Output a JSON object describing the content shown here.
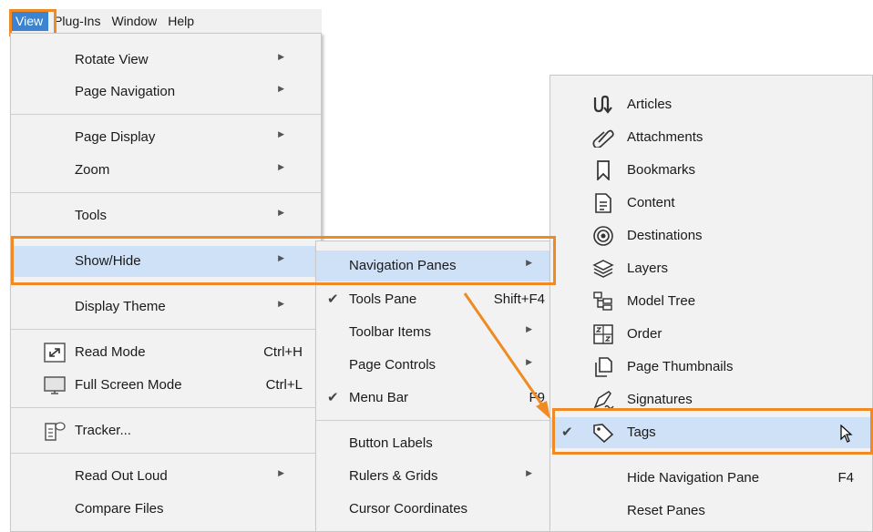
{
  "menubar": {
    "view": "View",
    "plugins": "Plug-Ins",
    "window": "Window",
    "help": "Help"
  },
  "view_menu": {
    "rotate_view": "Rotate View",
    "page_navigation": "Page Navigation",
    "page_display": "Page Display",
    "zoom": "Zoom",
    "tools": "Tools",
    "show_hide": "Show/Hide",
    "display_theme": "Display Theme",
    "read_mode": "Read Mode",
    "read_mode_sc": "Ctrl+H",
    "full_screen": "Full Screen Mode",
    "full_screen_sc": "Ctrl+L",
    "tracker": "Tracker...",
    "read_out_loud": "Read Out Loud",
    "compare_files": "Compare Files"
  },
  "showhide_menu": {
    "navigation_panes": "Navigation Panes",
    "tools_pane": "Tools Pane",
    "tools_pane_sc": "Shift+F4",
    "toolbar_items": "Toolbar Items",
    "page_controls": "Page Controls",
    "menu_bar": "Menu Bar",
    "menu_bar_sc": "F9",
    "button_labels": "Button Labels",
    "rulers_grids": "Rulers & Grids",
    "cursor_coordinates": "Cursor Coordinates"
  },
  "nav_panes_menu": {
    "articles": "Articles",
    "attachments": "Attachments",
    "bookmarks": "Bookmarks",
    "content": "Content",
    "destinations": "Destinations",
    "layers": "Layers",
    "model_tree": "Model Tree",
    "order": "Order",
    "page_thumbnails": "Page Thumbnails",
    "signatures": "Signatures",
    "tags": "Tags",
    "hide_nav_pane": "Hide Navigation Pane",
    "hide_nav_pane_sc": "F4",
    "reset_panes": "Reset Panes"
  },
  "colors": {
    "highlight": "#cfe1f7",
    "callout": "#ef8a24",
    "menubar_selected": "#3c84d0"
  }
}
